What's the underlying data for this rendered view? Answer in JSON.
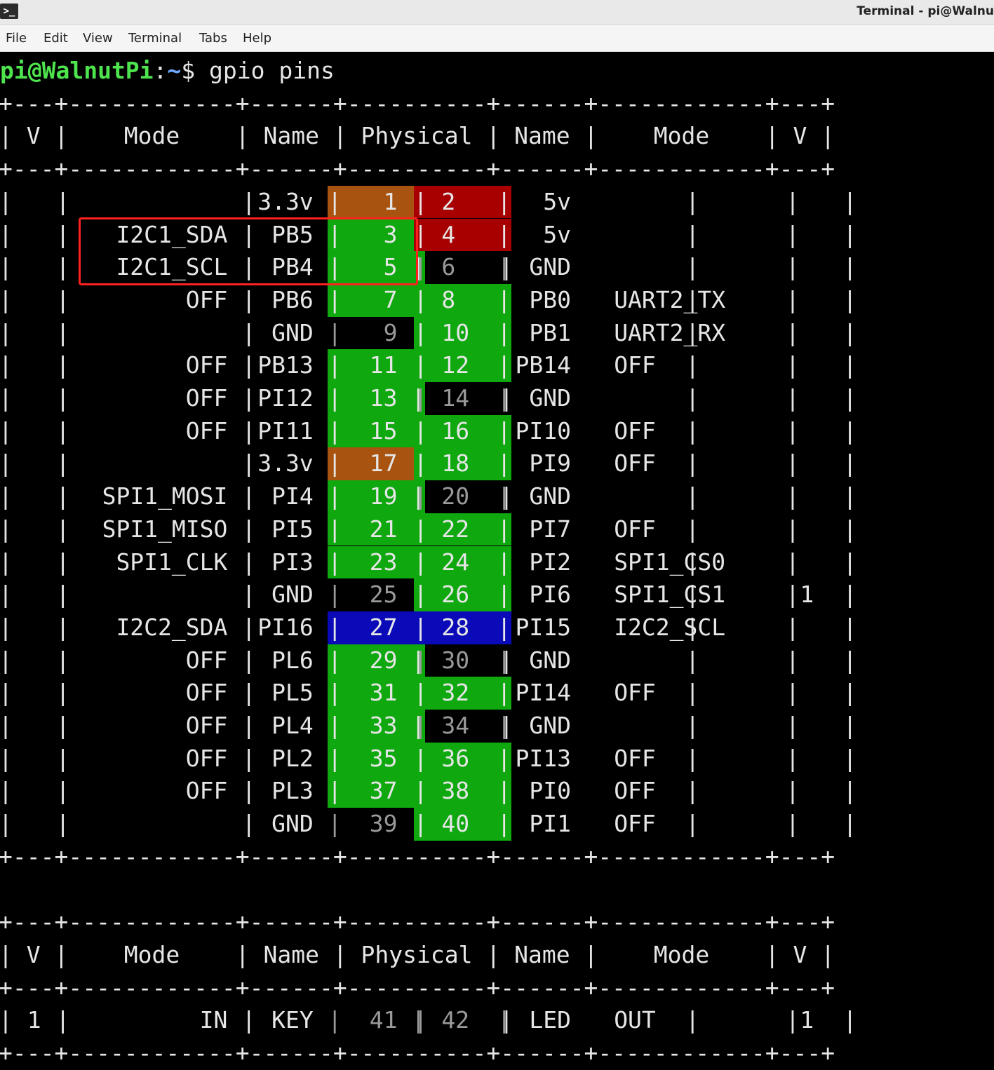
{
  "window": {
    "icon": ">_",
    "title": "Terminal - pi@Walnu"
  },
  "menu": [
    "File",
    "Edit",
    "View",
    "Terminal",
    "Tabs",
    "Help"
  ],
  "prompt": {
    "user_host": "pi@WalnutPi",
    "colon": ":",
    "path": "~",
    "symbol": "$",
    "command": " gpio pins"
  },
  "colors": {
    "green": "#0fa80f",
    "red": "#a80000",
    "orange": "#a8530f",
    "blue": "#0a0ab8",
    "highlight_box": "#ff2020"
  },
  "table1": {
    "border": "+---+------------+------+----------+------+------------+---+",
    "header": "| V |    Mode    | Name | Physical | Name |    Mode    | V |",
    "rows": [
      {
        "v1": "",
        "mode1": "",
        "name1": "3.3v",
        "p1": "1",
        "p2": "2",
        "name2": "5v",
        "mode2": "",
        "v2": "",
        "c1": "orange",
        "c2": "red"
      },
      {
        "v1": "",
        "mode1": "I2C1_SDA",
        "name1": "PB5",
        "p1": "3",
        "p2": "4",
        "name2": "5v",
        "mode2": "",
        "v2": "",
        "c1": "green",
        "c2": "red"
      },
      {
        "v1": "",
        "mode1": "I2C1_SCL",
        "name1": "PB4",
        "p1": "5",
        "p2": "6",
        "name2": "GND",
        "mode2": "",
        "v2": "",
        "c1": "green",
        "c2": "none"
      },
      {
        "v1": "",
        "mode1": "OFF",
        "name1": "PB6",
        "p1": "7",
        "p2": "8",
        "name2": "PB0",
        "mode2": "UART2_TX",
        "v2": "",
        "c1": "green",
        "c2": "green"
      },
      {
        "v1": "",
        "mode1": "",
        "name1": "GND",
        "p1": "9",
        "p2": "10",
        "name2": "PB1",
        "mode2": "UART2_RX",
        "v2": "",
        "c1": "none",
        "c2": "green"
      },
      {
        "v1": "",
        "mode1": "OFF",
        "name1": "PB13",
        "p1": "11",
        "p2": "12",
        "name2": "PB14",
        "mode2": "OFF",
        "v2": "",
        "c1": "green",
        "c2": "green"
      },
      {
        "v1": "",
        "mode1": "OFF",
        "name1": "PI12",
        "p1": "13",
        "p2": "14",
        "name2": "GND",
        "mode2": "",
        "v2": "",
        "c1": "green",
        "c2": "none"
      },
      {
        "v1": "",
        "mode1": "OFF",
        "name1": "PI11",
        "p1": "15",
        "p2": "16",
        "name2": "PI10",
        "mode2": "OFF",
        "v2": "",
        "c1": "green",
        "c2": "green"
      },
      {
        "v1": "",
        "mode1": "",
        "name1": "3.3v",
        "p1": "17",
        "p2": "18",
        "name2": "PI9",
        "mode2": "OFF",
        "v2": "",
        "c1": "orange",
        "c2": "green"
      },
      {
        "v1": "",
        "mode1": "SPI1_MOSI",
        "name1": "PI4",
        "p1": "19",
        "p2": "20",
        "name2": "GND",
        "mode2": "",
        "v2": "",
        "c1": "green",
        "c2": "none"
      },
      {
        "v1": "",
        "mode1": "SPI1_MISO",
        "name1": "PI5",
        "p1": "21",
        "p2": "22",
        "name2": "PI7",
        "mode2": "OFF",
        "v2": "",
        "c1": "green",
        "c2": "green"
      },
      {
        "v1": "",
        "mode1": "SPI1_CLK",
        "name1": "PI3",
        "p1": "23",
        "p2": "24",
        "name2": "PI2",
        "mode2": "SPI1_CS0",
        "v2": "",
        "c1": "green",
        "c2": "green"
      },
      {
        "v1": "",
        "mode1": "",
        "name1": "GND",
        "p1": "25",
        "p2": "26",
        "name2": "PI6",
        "mode2": "SPI1_CS1",
        "v2": "1",
        "c1": "none",
        "c2": "green"
      },
      {
        "v1": "",
        "mode1": "I2C2_SDA",
        "name1": "PI16",
        "p1": "27",
        "p2": "28",
        "name2": "PI15",
        "mode2": "I2C2_SCL",
        "v2": "",
        "c1": "blue",
        "c2": "blue"
      },
      {
        "v1": "",
        "mode1": "OFF",
        "name1": "PL6",
        "p1": "29",
        "p2": "30",
        "name2": "GND",
        "mode2": "",
        "v2": "",
        "c1": "green",
        "c2": "none"
      },
      {
        "v1": "",
        "mode1": "OFF",
        "name1": "PL5",
        "p1": "31",
        "p2": "32",
        "name2": "PI14",
        "mode2": "OFF",
        "v2": "",
        "c1": "green",
        "c2": "green"
      },
      {
        "v1": "",
        "mode1": "OFF",
        "name1": "PL4",
        "p1": "33",
        "p2": "34",
        "name2": "GND",
        "mode2": "",
        "v2": "",
        "c1": "green",
        "c2": "none"
      },
      {
        "v1": "",
        "mode1": "OFF",
        "name1": "PL2",
        "p1": "35",
        "p2": "36",
        "name2": "PI13",
        "mode2": "OFF",
        "v2": "",
        "c1": "green",
        "c2": "green"
      },
      {
        "v1": "",
        "mode1": "OFF",
        "name1": "PL3",
        "p1": "37",
        "p2": "38",
        "name2": "PI0",
        "mode2": "OFF",
        "v2": "",
        "c1": "green",
        "c2": "green"
      },
      {
        "v1": "",
        "mode1": "",
        "name1": "GND",
        "p1": "39",
        "p2": "40",
        "name2": "PI1",
        "mode2": "OFF",
        "v2": "",
        "c1": "none",
        "c2": "green"
      }
    ]
  },
  "table2": {
    "border": "+---+------------+------+----------+------+------------+---+",
    "header": "| V |    Mode    | Name | Physical | Name |    Mode    | V |",
    "rows": [
      {
        "v1": "1",
        "mode1": "IN",
        "name1": "KEY",
        "p1": "41",
        "p2": "42",
        "name2": "LED",
        "mode2": "OUT",
        "v2": "1",
        "c1": "none",
        "c2": "none"
      }
    ]
  }
}
